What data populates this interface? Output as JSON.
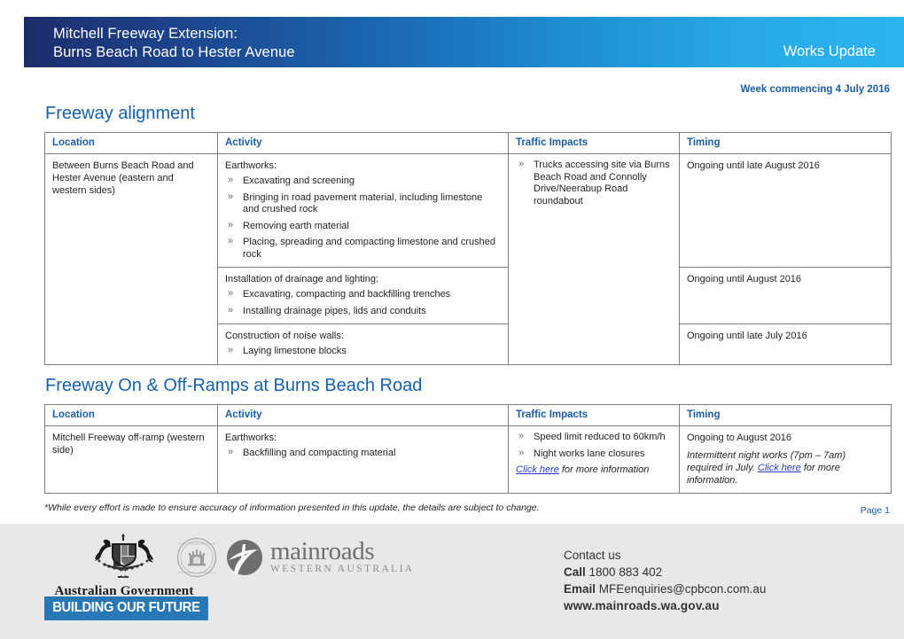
{
  "header": {
    "title_line1": "Mitchell Freeway Extension:",
    "title_line2": "Burns Beach Road to Hester Avenue",
    "works_update": "Works Update",
    "gradient_start": "#1d2d6b",
    "gradient_end": "#2ab4ef"
  },
  "week_commencing": "Week commencing 4 July 2016",
  "accent_blue": "#1b5ea6",
  "sections": [
    {
      "heading": "Freeway alignment",
      "columns": [
        "Location",
        "Activity",
        "Traffic Impacts",
        "Timing"
      ],
      "location": "Between Burns Beach Road and Hester Avenue (eastern and western sides)",
      "traffic_impacts": [
        "Trucks accessing site via Burns Beach Road and Connolly Drive/Neerabup Road roundabout"
      ],
      "rows": [
        {
          "activity_lead": "Earthworks:",
          "activity_bullets": [
            "Excavating and screening",
            "Bringing in road pavement material, including limestone and crushed rock",
            "Removing earth material",
            "Placing, spreading and compacting limestone and crushed rock"
          ],
          "timing": "Ongoing until late August 2016"
        },
        {
          "activity_lead": "Installation of drainage and lighting:",
          "activity_bullets": [
            "Excavating, compacting and backfilling trenches",
            "Installing drainage pipes, lids and conduits"
          ],
          "timing": "Ongoing until August 2016"
        },
        {
          "activity_lead": "Construction of noise walls:",
          "activity_bullets": [
            "Laying limestone blocks"
          ],
          "timing": "Ongoing until late July 2016"
        }
      ]
    },
    {
      "heading": "Freeway On & Off-Ramps at Burns Beach Road",
      "columns": [
        "Location",
        "Activity",
        "Traffic Impacts",
        "Timing"
      ],
      "location": "Mitchell Freeway off-ramp (western side)",
      "activity_lead": "Earthworks:",
      "activity_bullets": [
        "Backfilling and compacting material"
      ],
      "traffic_impacts": [
        "Speed limit reduced to 60km/h",
        "Night works lane closures"
      ],
      "traffic_note_link": "Click here",
      "traffic_note_rest": " for more information",
      "timing_line1": "Ongoing to August 2016",
      "timing_note_pre": "Intermittent night works (7pm – 7am) required in July. ",
      "timing_note_link": "Click here",
      "timing_note_post": " for more information."
    }
  ],
  "disclaimer": "*While every effort is made to ensure accuracy of information presented in this update, the details are subject to change.",
  "page_number": "Page 1",
  "footer": {
    "background": "#e7e8ea",
    "aus_gov_label": "Australian Government",
    "building_future": "BUILDING OUR FUTURE",
    "building_future_bg": "#2878b5",
    "mainroads_name": "mainroads",
    "mainroads_sub": "WESTERN AUSTRALIA",
    "contact_heading": "Contact us",
    "call_label": "Call",
    "call_value": "1800 883 402",
    "email_label": "Email",
    "email_value": "MFEenquiries@cpbcon.com.au",
    "website": "www.mainroads.wa.gov.au"
  }
}
